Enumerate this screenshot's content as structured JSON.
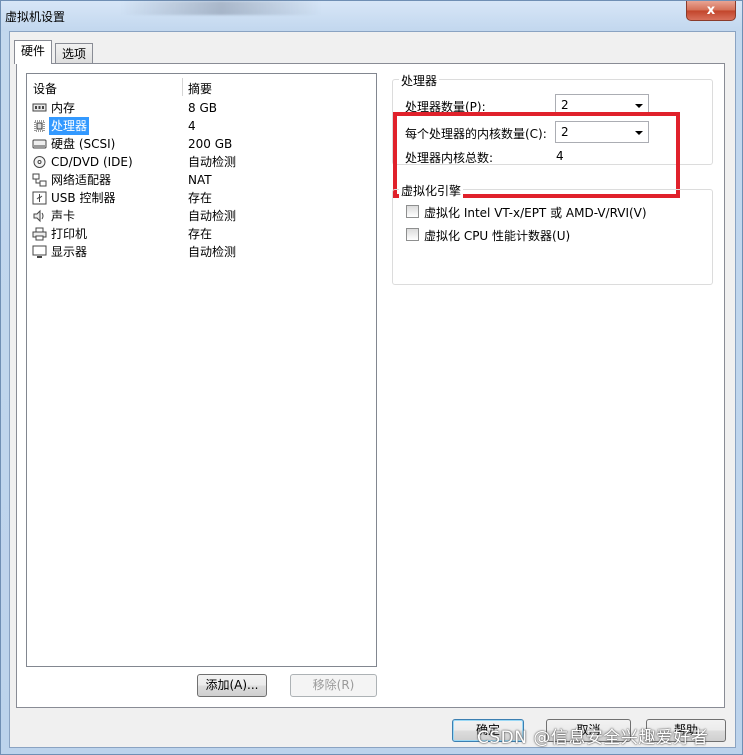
{
  "window": {
    "title": "虚拟机设置",
    "close_label": "x"
  },
  "tabs": [
    {
      "label": "硬件",
      "active": true
    },
    {
      "label": "选项",
      "active": false
    }
  ],
  "device_list": {
    "headers": {
      "device": "设备",
      "summary": "摘要"
    },
    "rows": [
      {
        "icon": "memory-icon",
        "name": "内存",
        "summary": "8 GB"
      },
      {
        "icon": "processor-icon",
        "name": "处理器",
        "summary": "4",
        "selected": true
      },
      {
        "icon": "hard-disk-icon",
        "name": "硬盘 (SCSI)",
        "summary": "200 GB"
      },
      {
        "icon": "cd-dvd-icon",
        "name": "CD/DVD (IDE)",
        "summary": "自动检测"
      },
      {
        "icon": "network-adapter-icon",
        "name": "网络适配器",
        "summary": "NAT"
      },
      {
        "icon": "usb-icon",
        "name": "USB 控制器",
        "summary": "存在"
      },
      {
        "icon": "sound-card-icon",
        "name": "声卡",
        "summary": "自动检测"
      },
      {
        "icon": "printer-icon",
        "name": "打印机",
        "summary": "存在"
      },
      {
        "icon": "display-icon",
        "name": "显示器",
        "summary": "自动检测"
      }
    ],
    "add_button": "添加(A)...",
    "remove_button": "移除(R)"
  },
  "processor": {
    "group_title": "处理器",
    "count_label": "处理器数量(P):",
    "count_value": "2",
    "cores_label": "每个处理器的内核数量(C):",
    "cores_value": "2",
    "total_label": "处理器内核总数:",
    "total_value": "4"
  },
  "virtualization": {
    "group_title": "虚拟化引擎",
    "option1": "虚拟化 Intel VT-x/EPT 或 AMD-V/RVI(V)",
    "option1_checked": false,
    "option2": "虚拟化 CPU 性能计数器(U)",
    "option2_checked": false
  },
  "footer": {
    "ok": "确定",
    "cancel": "取消",
    "help": "帮助"
  },
  "watermark": "CSDN @信息安全兴趣爱好者",
  "colors": {
    "highlight": "#e0212b",
    "selection": "#3399ff"
  }
}
